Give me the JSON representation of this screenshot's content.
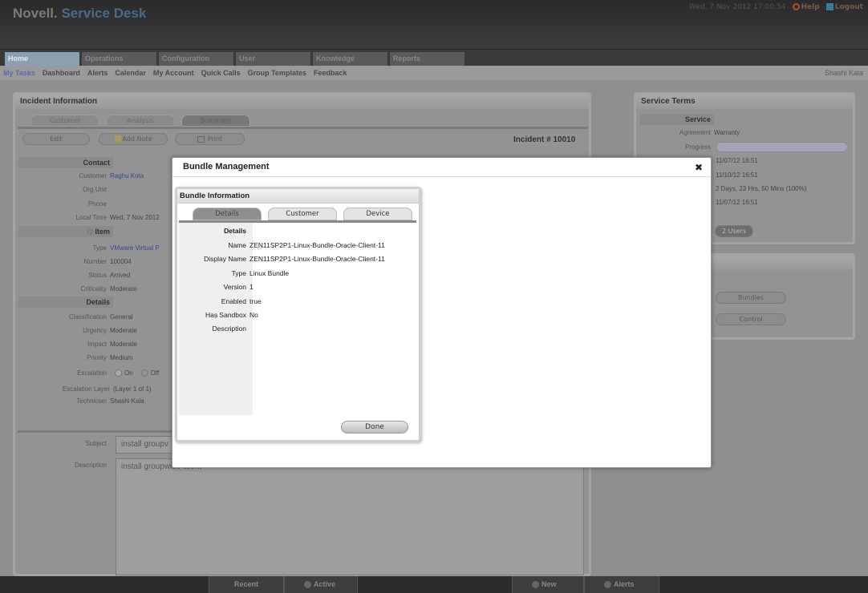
{
  "header": {
    "brand_novell": "Novell.",
    "brand_service": " Service Desk",
    "datetime": "Wed, 7 Nov 2012 17:00:54",
    "help": "Help",
    "logout": "Logout"
  },
  "tabs": [
    "Home",
    "Operations",
    "Configuration",
    "User",
    "Knowledge",
    "Reports"
  ],
  "subnav": {
    "items": [
      "My Tasks",
      "Dashboard",
      "Alerts",
      "Calendar",
      "My Account",
      "Quick Calls",
      "Group Templates",
      "Feedback"
    ],
    "user": "Shashi Kala"
  },
  "incident": {
    "title": "Incident Information",
    "tabs": [
      "Customer",
      "Analysis",
      "Summary"
    ],
    "edit": "Edit",
    "add_note": "Add Note",
    "print": "Print",
    "number": "Incident # 10010",
    "contact_head": "Contact",
    "customer_k": "Customer",
    "customer_v": "Raghu Kota",
    "org_k": "Org Unit",
    "phone_k": "Phone",
    "localtime_k": "Local Time",
    "localtime_v": "Wed, 7 Nov 2012",
    "item_head": "Item",
    "type_k": "Type",
    "type_v": "VMware Virtual P",
    "number_k": "Number",
    "number_v": "100004",
    "status_k": "Status",
    "status_v": "Arrived",
    "crit_k": "Criticality",
    "crit_v": "Moderate",
    "details_head": "Details",
    "class_k": "Classification",
    "class_v": "General",
    "urgency_k": "Urgency",
    "urgency_v": "Moderate",
    "impact_k": "Impact",
    "impact_v": "Moderate",
    "priority_k": "Priority",
    "priority_v": "Medium",
    "esc_k": "Escalation",
    "esc_on": "On",
    "esc_off": "Off",
    "esclayer_k": "Escalation Layer",
    "esclayer_v": "(Layer 1 of 1)",
    "tech_k": "Technician",
    "tech_v": "Shashi Kala",
    "subject_k": "Subject",
    "subject_v": "install groupv",
    "desc_k": "Description",
    "desc_v": "install groupwise client"
  },
  "service_terms": {
    "title": "Service Terms",
    "service_head": "Service",
    "agreement_k": "Agreement",
    "agreement_v": "Warranty",
    "progress_k": "Progress",
    "progress_fraction": 0,
    "date1": "11/07/12 16:51",
    "date2": "11/10/12 16:51",
    "duration": "2 Days, 23 Hrs, 50 Mins (100%)",
    "date3": "11/07/12 16:51",
    "users": "2 Users",
    "bundles": "Bundles",
    "control": "Control"
  },
  "footer": {
    "recent": "Recent",
    "active": "Active",
    "new": "New",
    "alerts": "Alerts"
  },
  "modal": {
    "title": "Bundle Management",
    "inner_title": "Bundle Information",
    "tabs": [
      "Details",
      "Customer",
      "Device"
    ],
    "details_head": "Details",
    "name_k": "Name",
    "name_v": "ZEN11SP2P1-Linux-Bundle-Oracle-Client-11",
    "dname_k": "Display Name",
    "dname_v": "ZEN11SP2P1-Linux-Bundle-Oracle-Client-11",
    "type_k": "Type",
    "type_v": "Linux Bundle",
    "version_k": "Version",
    "version_v": "1",
    "enabled_k": "Enabled",
    "enabled_v": "true",
    "sandbox_k": "Has Sandbox",
    "sandbox_v": "No",
    "desc_k": "Description",
    "desc_v": "",
    "done": "Done"
  }
}
